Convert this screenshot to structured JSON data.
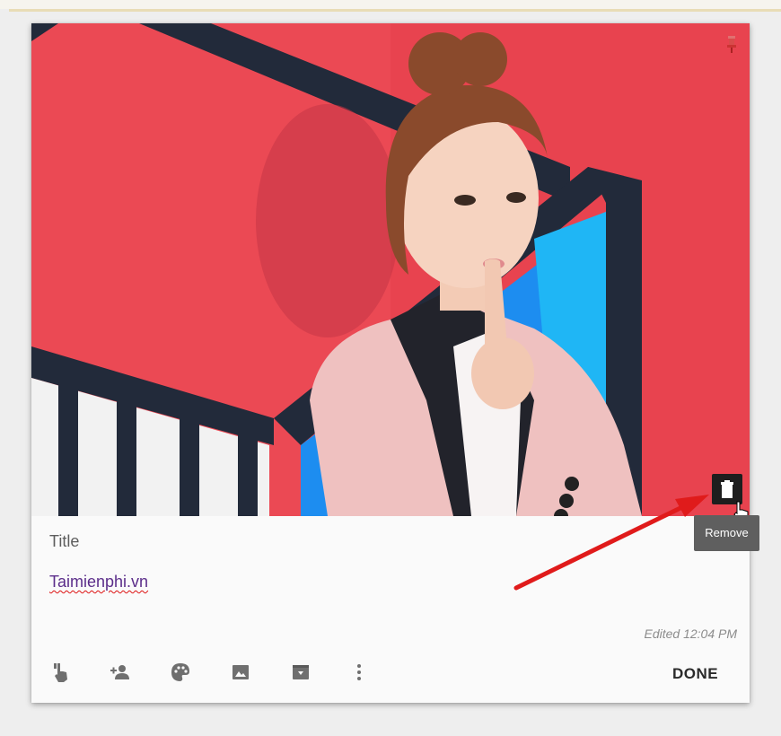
{
  "note": {
    "title_placeholder": "Title",
    "body_text": "Taimienphi.vn",
    "edited": "Edited 12:04 PM",
    "done_label": "DONE"
  },
  "image_tools": {
    "remove_tooltip": "Remove"
  },
  "icons": {
    "pin": "pin-icon",
    "remove": "trash-icon",
    "cursor": "hand-cursor-icon",
    "toolbar": [
      "remind-me-icon",
      "collaborator-icon",
      "palette-icon",
      "add-image-icon",
      "archive-icon",
      "more-vert-icon"
    ]
  },
  "colors": {
    "background": "#eeeeee",
    "card": "#fafafa",
    "image_red": "#e8434f",
    "arrow_red": "#e01b1b",
    "tooltip": "#5f5f5f"
  }
}
